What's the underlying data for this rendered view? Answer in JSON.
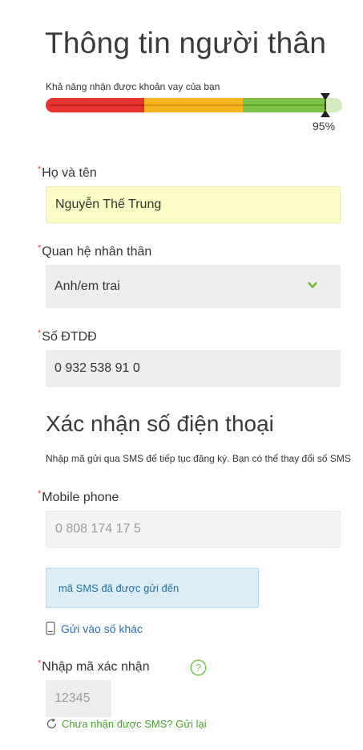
{
  "header": {
    "title": "Thông tin người thân"
  },
  "score": {
    "label": "Khả năng nhận được khoản vay của bạn",
    "value_text": "95%",
    "value": 0.95,
    "colors": {
      "red": "#e8322e",
      "orange": "#f5b51f",
      "green": "#7fc24a",
      "light_green": "#d3ecbd"
    }
  },
  "form": {
    "full_name": {
      "label": "Họ và tên",
      "required_mark": "*",
      "value": "Nguyễn Thế Trung"
    },
    "relation": {
      "label": "Quan hệ nhân thân",
      "required_mark": "*",
      "value": "Anh/em trai"
    },
    "phone": {
      "label": "Số ĐTDĐ",
      "required_mark": "*",
      "value": "0 932 538 91 0"
    }
  },
  "verify": {
    "title": "Xác nhận số điện thoại",
    "description": "Nhập mã gửi qua SMS để tiếp tục đăng ký. Bạn có thể thay đổi số SMS",
    "mobile": {
      "label": "Mobile phone",
      "required_mark": "*",
      "value": "0 808 174 17 5"
    },
    "notice": "mã SMS đã được gửi đến",
    "send_other": "Gửi vào số khác",
    "code": {
      "label": "Nhập mã xác nhận",
      "required_mark": "*",
      "placeholder": "12345"
    },
    "resend": "Chưa nhận được SMS? Gửi lại"
  },
  "icons": {
    "dropdown": "chevron-down-icon",
    "help": "help-icon",
    "phone": "mobile-phone-icon",
    "refresh": "refresh-icon"
  }
}
